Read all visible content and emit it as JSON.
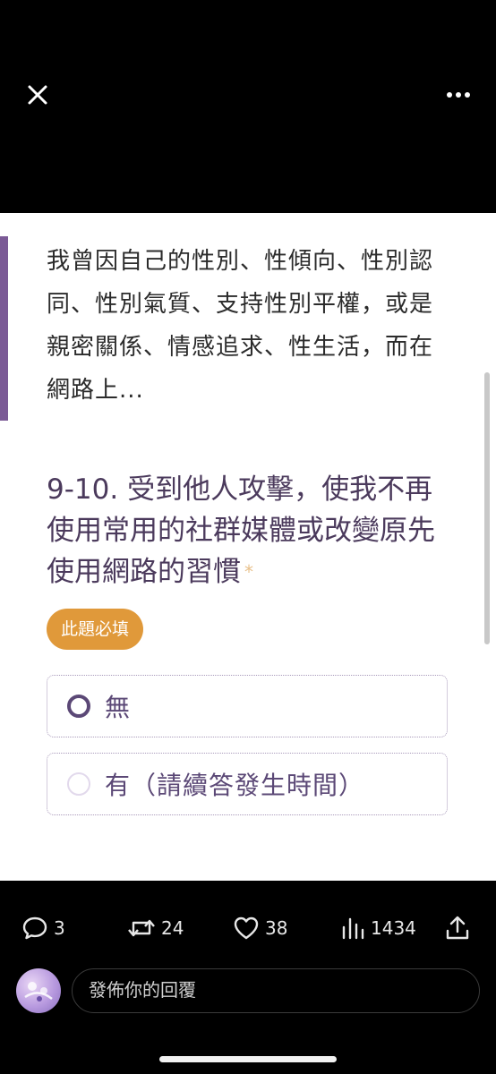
{
  "top_bar": {
    "close_icon": "close-icon",
    "more_icon": "more-horizontal-icon"
  },
  "intro_text": "我曾因自己的性別、性傾向、性別認同、性別氣質、支持性別平權，或是親密關係、情感追求、性生活，而在網路上...",
  "question": {
    "title": "9-10. 受到他人攻擊，使我不再使用常用的社群媒體或改變原先使用網路的習慣",
    "required_mark": "*"
  },
  "required_badge": "此題必填",
  "options": [
    {
      "label": "無"
    },
    {
      "label": "有（請續答發生時間）"
    }
  ],
  "action_bar": {
    "replies": "3",
    "reposts": "24",
    "likes": "38",
    "views": "1434"
  },
  "reply": {
    "placeholder": "發佈你的回覆"
  },
  "colors": {
    "accent": "#7b5a96",
    "badge": "#e0993a",
    "question": "#4b3a5c"
  }
}
